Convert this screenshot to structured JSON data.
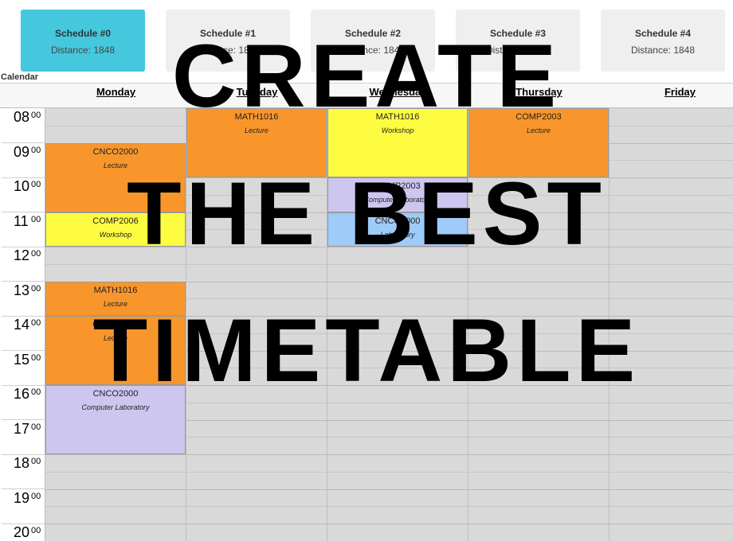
{
  "schedules": [
    {
      "title": "Schedule #0",
      "distance": "Distance: 1848"
    },
    {
      "title": "Schedule #1",
      "distance": "Distance: 1848"
    },
    {
      "title": "Schedule #2",
      "distance": "Distance: 1848"
    },
    {
      "title": "Schedule #3",
      "distance": "Distance: 1848"
    },
    {
      "title": "Schedule #4",
      "distance": "Distance: 1848"
    }
  ],
  "active_schedule_index": 0,
  "colors": {
    "active_card": "#45c8de",
    "lecture": "#f8962c",
    "workshop": "#fdfc41",
    "computer_laboratory": "#cdc6ef",
    "laboratory": "#9ecbf7"
  },
  "calendar": {
    "label": "Calendar",
    "days": [
      "Monday",
      "Tuesday",
      "Wednesday",
      "Thursday",
      "Friday"
    ],
    "hours": [
      {
        "h": "08",
        "m": "00"
      },
      {
        "h": "09",
        "m": "00"
      },
      {
        "h": "10",
        "m": "00"
      },
      {
        "h": "11",
        "m": "00"
      },
      {
        "h": "12",
        "m": "00"
      },
      {
        "h": "13",
        "m": "00"
      },
      {
        "h": "14",
        "m": "00"
      },
      {
        "h": "15",
        "m": "00"
      },
      {
        "h": "16",
        "m": "00"
      },
      {
        "h": "17",
        "m": "00"
      },
      {
        "h": "18",
        "m": "00"
      },
      {
        "h": "19",
        "m": "00"
      },
      {
        "h": "20",
        "m": "00"
      }
    ]
  },
  "events": [
    {
      "day": 0,
      "start": "09:00",
      "end": "11:00",
      "code": "CNCO2000",
      "type": "Lecture",
      "color": "#f8962c"
    },
    {
      "day": 0,
      "start": "11:00",
      "end": "12:00",
      "code": "COMP2006",
      "type": "Workshop",
      "color": "#fdfc41"
    },
    {
      "day": 0,
      "start": "13:00",
      "end": "14:00",
      "code": "MATH1016",
      "type": "Lecture",
      "color": "#f8962c"
    },
    {
      "day": 0,
      "start": "14:00",
      "end": "16:00",
      "code": "COMP2006",
      "type": "Lecture",
      "color": "#f8962c"
    },
    {
      "day": 0,
      "start": "16:00",
      "end": "18:00",
      "code": "CNCO2000",
      "type": "Computer Laboratory",
      "color": "#cdc6ef"
    },
    {
      "day": 1,
      "start": "08:00",
      "end": "10:00",
      "code": "MATH1016",
      "type": "Lecture",
      "color": "#f8962c"
    },
    {
      "day": 2,
      "start": "08:00",
      "end": "10:00",
      "code": "MATH1016",
      "type": "Workshop",
      "color": "#fdfc41"
    },
    {
      "day": 2,
      "start": "10:00",
      "end": "11:00",
      "code": "COMP2003",
      "type": "Computer Laboratory",
      "color": "#cdc6ef"
    },
    {
      "day": 2,
      "start": "11:00",
      "end": "12:00",
      "code": "CNCO2000",
      "type": "Laboratory",
      "color": "#9ecbf7"
    },
    {
      "day": 3,
      "start": "08:00",
      "end": "10:00",
      "code": "COMP2003",
      "type": "Lecture",
      "color": "#f8962c"
    }
  ],
  "overlay": {
    "line1": "CREATE",
    "line2": "THE BEST",
    "line3": "TIMETABLE"
  }
}
